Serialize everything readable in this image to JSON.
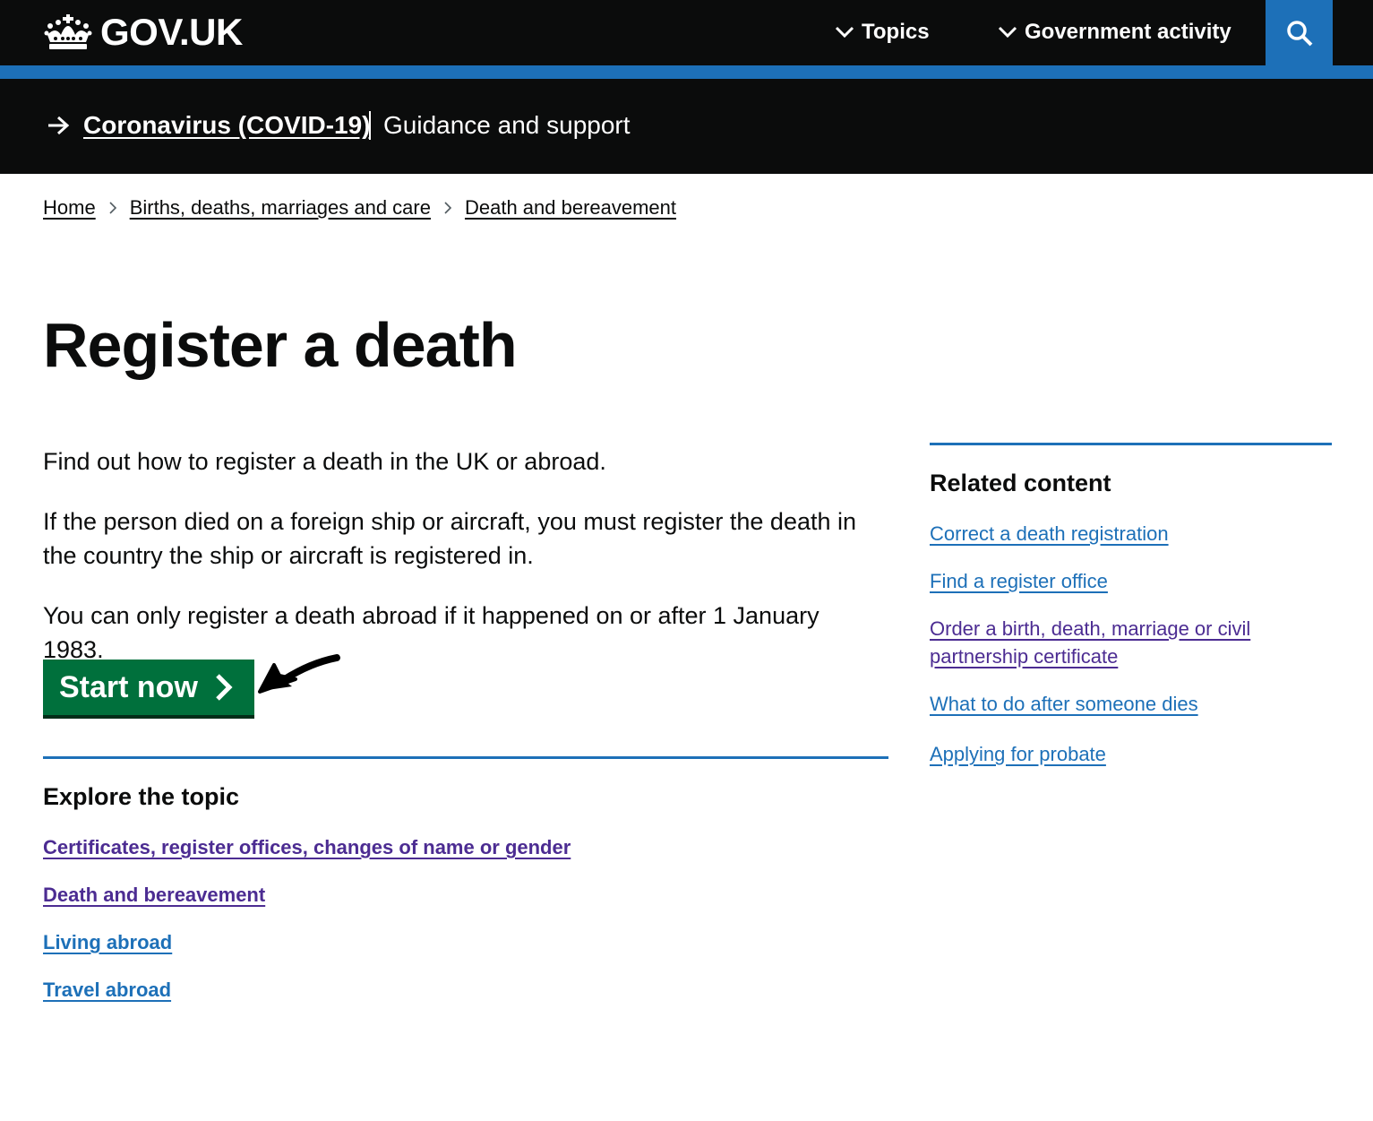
{
  "header": {
    "logo_text": "GOV.UK",
    "nav": {
      "topics": "Topics",
      "government_activity": "Government activity"
    },
    "search_icon": "search-icon"
  },
  "covid_banner": {
    "link": "Coronavirus (COVID-19)",
    "subtitle": "Guidance and support"
  },
  "breadcrumbs": [
    "Home",
    "Births, deaths, marriages and care",
    "Death and bereavement"
  ],
  "page": {
    "title": "Register a death",
    "paragraphs": [
      "Find out how to register a death in the UK or abroad.",
      "If the person died on a foreign ship or aircraft, you must register the death in the country the ship or aircraft is registered in.",
      "You can only register a death abroad if it happened on or after 1 January 1983."
    ],
    "start_button": "Start now"
  },
  "explore": {
    "heading": "Explore the topic",
    "links": [
      "Certificates, register offices, changes of name or gender",
      "Death and bereavement",
      "Living abroad",
      "Travel abroad"
    ]
  },
  "related": {
    "heading": "Related content",
    "links": [
      "Correct a death registration",
      "Find a register office",
      "Order a birth, death, marriage or civil partnership certificate",
      "What to do after someone dies",
      "Applying for probate"
    ]
  },
  "colors": {
    "header_bg": "#0b0c0c",
    "brand_blue": "#1d70b8",
    "button_green": "#00703c",
    "visited_link": "#4c2c92",
    "link": "#1d70b8"
  }
}
